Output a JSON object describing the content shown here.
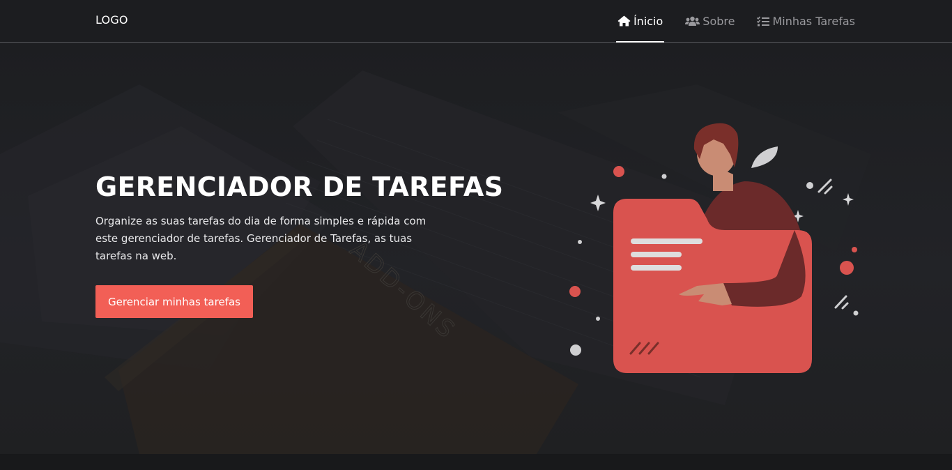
{
  "navbar": {
    "logo": "LOGO",
    "items": [
      {
        "label": "Ínicio",
        "icon": "home-icon",
        "active": true
      },
      {
        "label": "Sobre",
        "icon": "users-icon",
        "active": false
      },
      {
        "label": "Minhas Tarefas",
        "icon": "tasks-icon",
        "active": false
      }
    ]
  },
  "hero": {
    "title": "GERENCIADOR DE TAREFAS",
    "subtitle": "Organize as suas tarefas do dia de forma simples e rápida com este gerenciador de tarefas. Gerenciador de Tarefas, as tuas tarefas na web.",
    "cta_label": "Gerenciar minhas tarefas",
    "background_text": "ADD-ONS"
  },
  "colors": {
    "accent": "#f25f56",
    "folder": "#d9534f",
    "background": "#1b1c1f"
  }
}
